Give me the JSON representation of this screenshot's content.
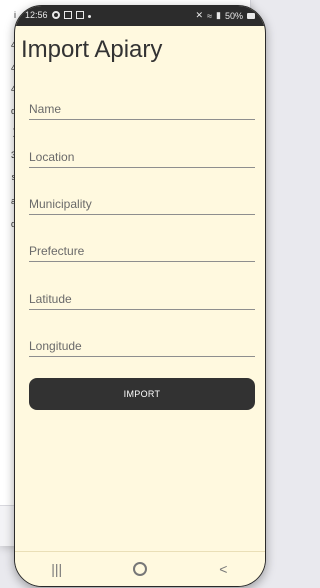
{
  "background": {
    "side_items": [
      "i",
      "4",
      "4",
      "4",
      "d",
      ")",
      "3",
      "s",
      "a",
      "d"
    ]
  },
  "statusbar": {
    "time": "12:56",
    "battery": "50%"
  },
  "screen": {
    "title": "Import Apiary",
    "fields": [
      {
        "label": "Name"
      },
      {
        "label": "Location"
      },
      {
        "label": "Municipality"
      },
      {
        "label": "Prefecture"
      },
      {
        "label": "Latitude"
      },
      {
        "label": "Longitude"
      }
    ],
    "import_button": "IMPORT"
  },
  "colors": {
    "screen_background": "#fff9df",
    "button_background": "#323232",
    "statusbar_background": "#2c2c2c"
  },
  "navbar": {
    "recents_glyph": "|||",
    "back_glyph": "<"
  }
}
